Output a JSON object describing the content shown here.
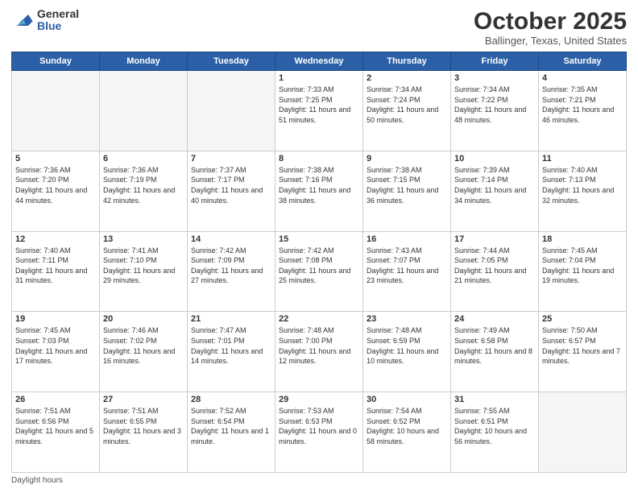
{
  "header": {
    "logo_general": "General",
    "logo_blue": "Blue",
    "month_title": "October 2025",
    "location": "Ballinger, Texas, United States"
  },
  "days_of_week": [
    "Sunday",
    "Monday",
    "Tuesday",
    "Wednesday",
    "Thursday",
    "Friday",
    "Saturday"
  ],
  "weeks": [
    [
      {
        "day": "",
        "sunrise": "",
        "sunset": "",
        "daylight": "",
        "empty": true
      },
      {
        "day": "",
        "sunrise": "",
        "sunset": "",
        "daylight": "",
        "empty": true
      },
      {
        "day": "",
        "sunrise": "",
        "sunset": "",
        "daylight": "",
        "empty": true
      },
      {
        "day": "1",
        "sunrise": "Sunrise: 7:33 AM",
        "sunset": "Sunset: 7:25 PM",
        "daylight": "Daylight: 11 hours and 51 minutes."
      },
      {
        "day": "2",
        "sunrise": "Sunrise: 7:34 AM",
        "sunset": "Sunset: 7:24 PM",
        "daylight": "Daylight: 11 hours and 50 minutes."
      },
      {
        "day": "3",
        "sunrise": "Sunrise: 7:34 AM",
        "sunset": "Sunset: 7:22 PM",
        "daylight": "Daylight: 11 hours and 48 minutes."
      },
      {
        "day": "4",
        "sunrise": "Sunrise: 7:35 AM",
        "sunset": "Sunset: 7:21 PM",
        "daylight": "Daylight: 11 hours and 46 minutes."
      }
    ],
    [
      {
        "day": "5",
        "sunrise": "Sunrise: 7:36 AM",
        "sunset": "Sunset: 7:20 PM",
        "daylight": "Daylight: 11 hours and 44 minutes."
      },
      {
        "day": "6",
        "sunrise": "Sunrise: 7:36 AM",
        "sunset": "Sunset: 7:19 PM",
        "daylight": "Daylight: 11 hours and 42 minutes."
      },
      {
        "day": "7",
        "sunrise": "Sunrise: 7:37 AM",
        "sunset": "Sunset: 7:17 PM",
        "daylight": "Daylight: 11 hours and 40 minutes."
      },
      {
        "day": "8",
        "sunrise": "Sunrise: 7:38 AM",
        "sunset": "Sunset: 7:16 PM",
        "daylight": "Daylight: 11 hours and 38 minutes."
      },
      {
        "day": "9",
        "sunrise": "Sunrise: 7:38 AM",
        "sunset": "Sunset: 7:15 PM",
        "daylight": "Daylight: 11 hours and 36 minutes."
      },
      {
        "day": "10",
        "sunrise": "Sunrise: 7:39 AM",
        "sunset": "Sunset: 7:14 PM",
        "daylight": "Daylight: 11 hours and 34 minutes."
      },
      {
        "day": "11",
        "sunrise": "Sunrise: 7:40 AM",
        "sunset": "Sunset: 7:13 PM",
        "daylight": "Daylight: 11 hours and 32 minutes."
      }
    ],
    [
      {
        "day": "12",
        "sunrise": "Sunrise: 7:40 AM",
        "sunset": "Sunset: 7:11 PM",
        "daylight": "Daylight: 11 hours and 31 minutes."
      },
      {
        "day": "13",
        "sunrise": "Sunrise: 7:41 AM",
        "sunset": "Sunset: 7:10 PM",
        "daylight": "Daylight: 11 hours and 29 minutes."
      },
      {
        "day": "14",
        "sunrise": "Sunrise: 7:42 AM",
        "sunset": "Sunset: 7:09 PM",
        "daylight": "Daylight: 11 hours and 27 minutes."
      },
      {
        "day": "15",
        "sunrise": "Sunrise: 7:42 AM",
        "sunset": "Sunset: 7:08 PM",
        "daylight": "Daylight: 11 hours and 25 minutes."
      },
      {
        "day": "16",
        "sunrise": "Sunrise: 7:43 AM",
        "sunset": "Sunset: 7:07 PM",
        "daylight": "Daylight: 11 hours and 23 minutes."
      },
      {
        "day": "17",
        "sunrise": "Sunrise: 7:44 AM",
        "sunset": "Sunset: 7:05 PM",
        "daylight": "Daylight: 11 hours and 21 minutes."
      },
      {
        "day": "18",
        "sunrise": "Sunrise: 7:45 AM",
        "sunset": "Sunset: 7:04 PM",
        "daylight": "Daylight: 11 hours and 19 minutes."
      }
    ],
    [
      {
        "day": "19",
        "sunrise": "Sunrise: 7:45 AM",
        "sunset": "Sunset: 7:03 PM",
        "daylight": "Daylight: 11 hours and 17 minutes."
      },
      {
        "day": "20",
        "sunrise": "Sunrise: 7:46 AM",
        "sunset": "Sunset: 7:02 PM",
        "daylight": "Daylight: 11 hours and 16 minutes."
      },
      {
        "day": "21",
        "sunrise": "Sunrise: 7:47 AM",
        "sunset": "Sunset: 7:01 PM",
        "daylight": "Daylight: 11 hours and 14 minutes."
      },
      {
        "day": "22",
        "sunrise": "Sunrise: 7:48 AM",
        "sunset": "Sunset: 7:00 PM",
        "daylight": "Daylight: 11 hours and 12 minutes."
      },
      {
        "day": "23",
        "sunrise": "Sunrise: 7:48 AM",
        "sunset": "Sunset: 6:59 PM",
        "daylight": "Daylight: 11 hours and 10 minutes."
      },
      {
        "day": "24",
        "sunrise": "Sunrise: 7:49 AM",
        "sunset": "Sunset: 6:58 PM",
        "daylight": "Daylight: 11 hours and 8 minutes."
      },
      {
        "day": "25",
        "sunrise": "Sunrise: 7:50 AM",
        "sunset": "Sunset: 6:57 PM",
        "daylight": "Daylight: 11 hours and 7 minutes."
      }
    ],
    [
      {
        "day": "26",
        "sunrise": "Sunrise: 7:51 AM",
        "sunset": "Sunset: 6:56 PM",
        "daylight": "Daylight: 11 hours and 5 minutes."
      },
      {
        "day": "27",
        "sunrise": "Sunrise: 7:51 AM",
        "sunset": "Sunset: 6:55 PM",
        "daylight": "Daylight: 11 hours and 3 minutes."
      },
      {
        "day": "28",
        "sunrise": "Sunrise: 7:52 AM",
        "sunset": "Sunset: 6:54 PM",
        "daylight": "Daylight: 11 hours and 1 minute."
      },
      {
        "day": "29",
        "sunrise": "Sunrise: 7:53 AM",
        "sunset": "Sunset: 6:53 PM",
        "daylight": "Daylight: 11 hours and 0 minutes."
      },
      {
        "day": "30",
        "sunrise": "Sunrise: 7:54 AM",
        "sunset": "Sunset: 6:52 PM",
        "daylight": "Daylight: 10 hours and 58 minutes."
      },
      {
        "day": "31",
        "sunrise": "Sunrise: 7:55 AM",
        "sunset": "Sunset: 6:51 PM",
        "daylight": "Daylight: 10 hours and 56 minutes."
      },
      {
        "day": "",
        "sunrise": "",
        "sunset": "",
        "daylight": "",
        "empty": true
      }
    ]
  ],
  "footer": {
    "daylight_label": "Daylight hours"
  }
}
